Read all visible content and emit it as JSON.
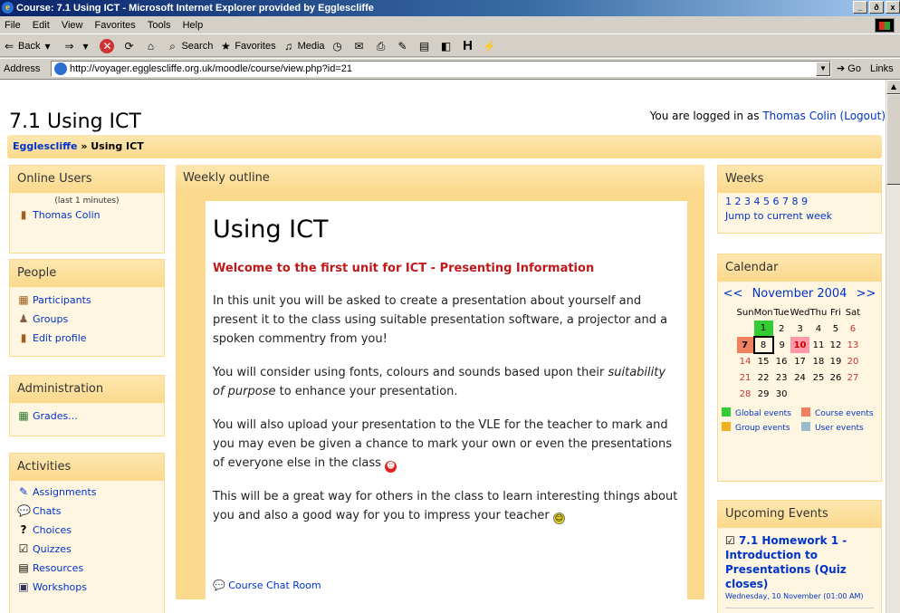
{
  "window": {
    "title": "Course: 7.1 Using ICT - Microsoft Internet Explorer provided by Egglescliffe",
    "buttons": [
      "_",
      "ð",
      "x"
    ]
  },
  "menu": [
    "File",
    "Edit",
    "View",
    "Favorites",
    "Tools",
    "Help"
  ],
  "toolbar": {
    "back": "Back",
    "search": "Search",
    "favorites": "Favorites",
    "media": "Media"
  },
  "address": {
    "label": "Address",
    "url": "http://voyager.egglescliffe.org.uk/moodle/course/view.php?id=21",
    "go": "Go",
    "links": "Links"
  },
  "page": {
    "course_title": "7.1 Using ICT",
    "login_prefix": "You are logged in as",
    "user": "Thomas Colin",
    "logout": "(Logout)",
    "breadcrumb_site": "Egglescliffe",
    "breadcrumb_sep": " » ",
    "breadcrumb_here": "Using ICT"
  },
  "online_users": {
    "title": "Online Users",
    "note": "(last 1 minutes)",
    "users": [
      "Thomas Colin"
    ]
  },
  "people": {
    "title": "People",
    "items": [
      "Participants",
      "Groups",
      "Edit profile"
    ]
  },
  "administration": {
    "title": "Administration",
    "items": [
      "Grades..."
    ]
  },
  "activities": {
    "title": "Activities",
    "items": [
      "Assignments",
      "Chats",
      "Choices",
      "Quizzes",
      "Resources",
      "Workshops"
    ]
  },
  "outline": {
    "title": "Weekly outline",
    "heading": "Using ICT",
    "welcome": "Welcome to the first unit for ICT - Presenting Information",
    "p1": "In this unit you will be asked to create a presentation about yourself and present it to the class using suitable presentation software, a projector and a spoken commentry from you!",
    "p2a": "You will consider using fonts, colours and sounds based upon their",
    "p2em": "suitability of purpose",
    "p2b": "to enhance your presentation.",
    "p3": "You will also upload your presentation to the VLE for the teacher to mark and you may even be given a chance to mark your own or even the presentations of everyone else in the class",
    "p4": "This will be a great way for others in the class to learn interesting things about you and also a good way for you to impress your teacher",
    "chat_room": "Course Chat Room"
  },
  "weeks": {
    "title": "Weeks",
    "numbers": "1 2 3 4 5 6 7 8 9",
    "jump": "Jump to current week"
  },
  "calendar": {
    "title": "Calendar",
    "prev": "<<",
    "month": "November 2004",
    "next": ">>",
    "days": [
      "Sun",
      "Mon",
      "Tue",
      "Wed",
      "Thu",
      "Fri",
      "Sat"
    ],
    "rows": [
      [
        "",
        "1",
        "2",
        "3",
        "4",
        "5",
        "6"
      ],
      [
        "7",
        "8",
        "9",
        "10",
        "11",
        "12",
        "13"
      ],
      [
        "14",
        "15",
        "16",
        "17",
        "18",
        "19",
        "20"
      ],
      [
        "21",
        "22",
        "23",
        "24",
        "25",
        "26",
        "27"
      ],
      [
        "28",
        "29",
        "30",
        "",
        "",
        "",
        ""
      ]
    ],
    "legend": {
      "global": "Global events",
      "course": "Course events",
      "group": "Group events",
      "user": "User events"
    },
    "colors": {
      "global": "#33cc33",
      "course": "#f08060",
      "group": "#f0b020",
      "user": "#99bbcc"
    }
  },
  "upcoming": {
    "title": "Upcoming Events",
    "event": "7.1 Homework 1 - Introduction to Presentations (Quiz closes)",
    "date": "Wednesday, 10 November (01:00 AM)"
  }
}
